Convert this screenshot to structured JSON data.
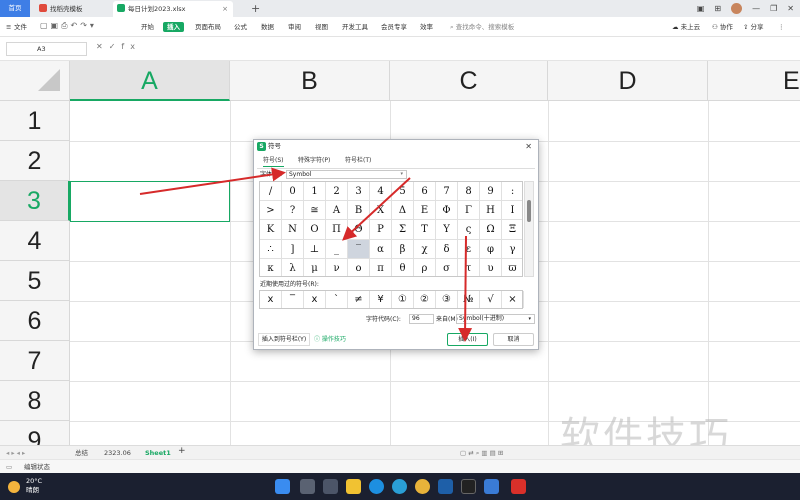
{
  "tabs": {
    "home": "首页",
    "template": "找稻壳模板",
    "file": "每日计划2023.xlsx",
    "new_tab": "+"
  },
  "window": {
    "minimize": "—",
    "restore": "❐",
    "close": "✕"
  },
  "menu": {
    "file": "文件",
    "items": [
      "开始",
      "插入",
      "页面布局",
      "公式",
      "数据",
      "审阅",
      "视图",
      "开发工具",
      "会员专享",
      "效率"
    ],
    "active": "插入",
    "search": "查找命令、搜索模板",
    "cloud": "未上云",
    "collab": "协作",
    "share": "分享"
  },
  "formula_bar": {
    "cell_ref": "A3",
    "fx": "fx"
  },
  "grid": {
    "columns": [
      "A",
      "B",
      "C",
      "D",
      "E"
    ],
    "rows": [
      "1",
      "2",
      "3",
      "4",
      "5",
      "6",
      "7",
      "8",
      "9"
    ],
    "active_cell": "A3"
  },
  "dialog": {
    "title": "符号",
    "tabs": [
      "符号(S)",
      "特殊字符(P)",
      "符号栏(T)"
    ],
    "font_label": "字体(F):",
    "font_value": "Symbol",
    "symbols": [
      [
        "/",
        "0",
        "1",
        "2",
        "3",
        "4",
        "5",
        "6",
        "7",
        "8",
        "9",
        ":"
      ],
      [
        ">",
        "?",
        "≅",
        "Α",
        "Β",
        "Χ",
        "Δ",
        "Ε",
        "Φ",
        "Γ",
        "Η",
        "Ι"
      ],
      [
        "Κ",
        "Ν",
        "Ο",
        "Π",
        "Θ",
        "Ρ",
        "Σ",
        "Τ",
        "Υ",
        "ς",
        "Ω",
        "Ξ"
      ],
      [
        "∴",
        "]",
        "⊥",
        "_",
        "‾",
        "α",
        "β",
        "χ",
        "δ",
        "ε",
        "φ",
        "γ"
      ],
      [
        "κ",
        "λ",
        "μ",
        "ν",
        "ο",
        "π",
        "θ",
        "ρ",
        "σ",
        "τ",
        "υ",
        "ϖ"
      ]
    ],
    "selected_symbol": "‾",
    "recent_label": "近期使用过的符号(R):",
    "recent": [
      "x",
      "‾",
      "x",
      "`",
      "≠",
      "¥",
      "①",
      "②",
      "③",
      "№",
      "√",
      "×"
    ],
    "code_label": "字符代码(C):",
    "code_value": "96",
    "from_label": "来自(M)",
    "from_value": "Symbol(十进制)",
    "toolbar_button": "插入到符号栏(Y)",
    "tips": "操作技巧",
    "insert_button": "插入(I)",
    "cancel_button": "取消",
    "close": "✕"
  },
  "sheets": {
    "tabs": [
      "总结",
      "2323.06",
      "Sheet1"
    ],
    "active": "Sheet1",
    "add": "+"
  },
  "status": {
    "text": "编辑状态"
  },
  "taskbar": {
    "temp": "20°C",
    "weather": "晴朗"
  },
  "watermark": "软件技巧",
  "colors": {
    "accent": "#17a863",
    "arrow": "#d62a2a",
    "home_tab": "#3e7ee6"
  }
}
